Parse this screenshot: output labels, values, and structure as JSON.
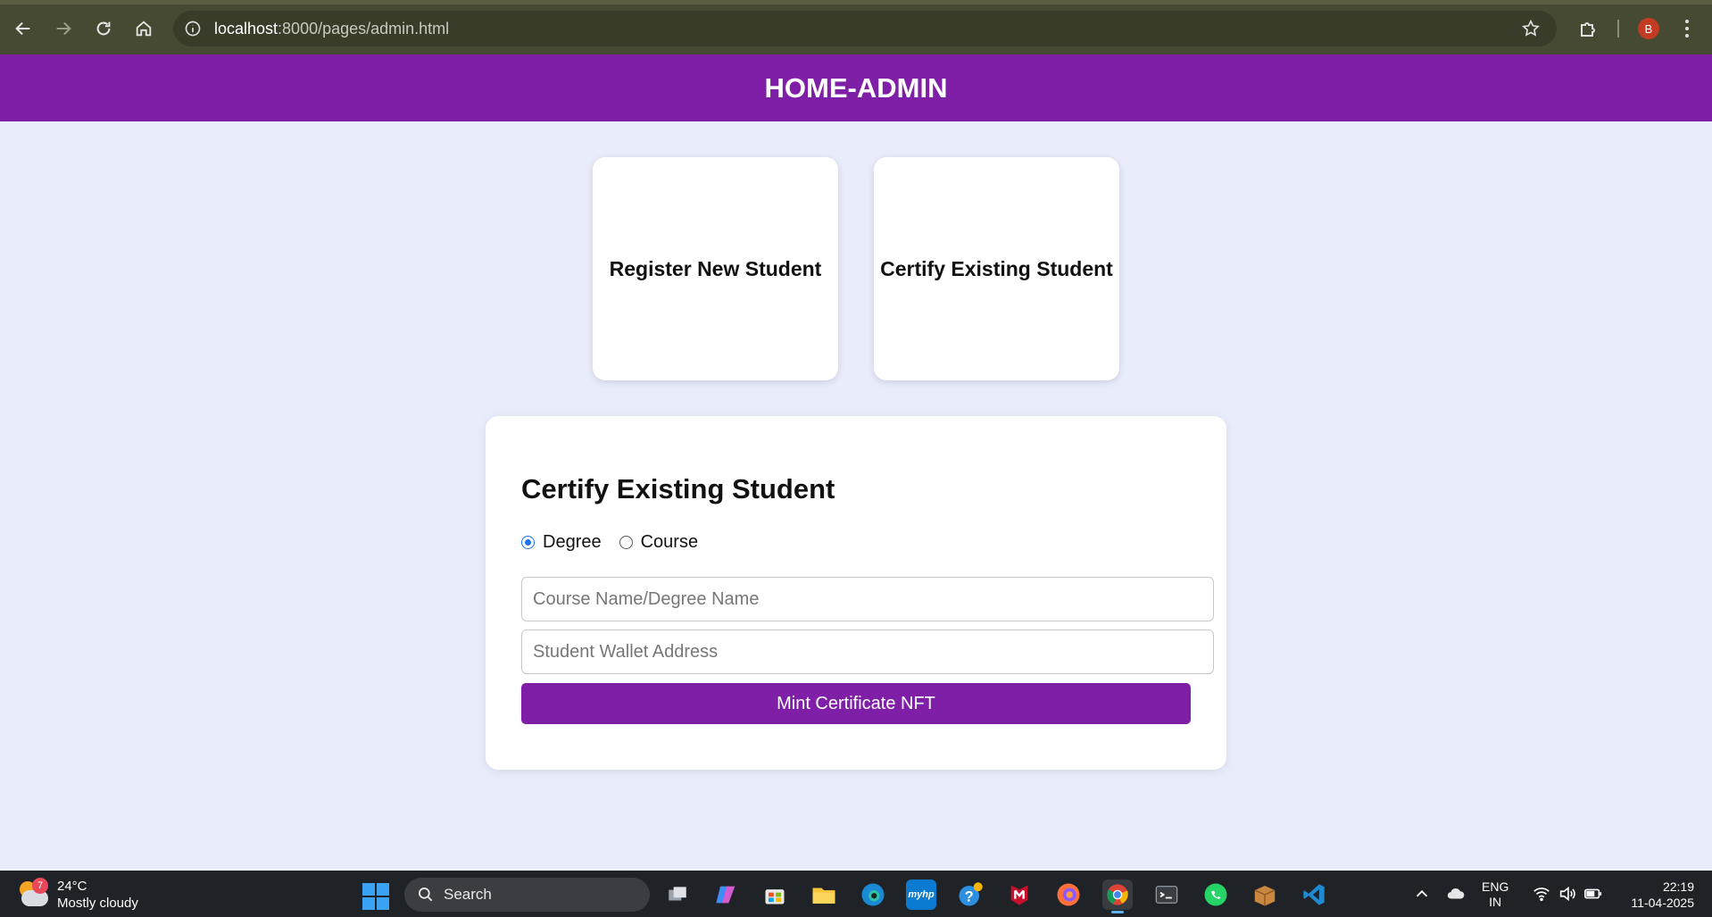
{
  "browser": {
    "url_host": "localhost",
    "url_rest": ":8000/pages/admin.html",
    "profile_initial": "B"
  },
  "header": {
    "title": "HOME-ADMIN"
  },
  "cards": [
    {
      "label": "Register New Student"
    },
    {
      "label": "Certify Existing Student"
    }
  ],
  "form": {
    "title": "Certify Existing Student",
    "radio_options": [
      {
        "label": "Degree",
        "checked": true
      },
      {
        "label": "Course",
        "checked": false
      }
    ],
    "course_name": {
      "value": "",
      "placeholder": "Course Name/Degree Name"
    },
    "wallet": {
      "value": "",
      "placeholder": "Student Wallet Address"
    },
    "submit_label": "Mint Certificate NFT"
  },
  "taskbar": {
    "weather_temp": "24°C",
    "weather_desc": "Mostly cloudy",
    "weather_badge": "7",
    "search_label": "Search",
    "lang_line1": "ENG",
    "lang_line2": "IN",
    "time": "22:19",
    "date": "11-04-2025"
  },
  "colors": {
    "accent": "#7f1fa8",
    "page_bg": "#e8ecfb"
  }
}
